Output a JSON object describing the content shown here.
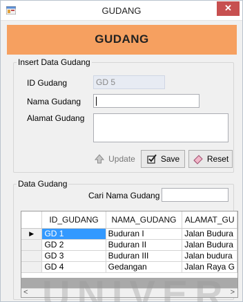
{
  "window": {
    "title": "GUDANG",
    "close_glyph": "✕",
    "icon": "app-window-icon",
    "close_color": "#c75050"
  },
  "banner": {
    "title": "GUDANG",
    "color": "#f6a060"
  },
  "insert_group": {
    "legend": "Insert Data Gudang",
    "id_label": "ID Gudang",
    "id_value": "GD 5",
    "nama_label": "Nama Gudang",
    "nama_value": "",
    "alamat_label": "Alamat Gudang",
    "alamat_value": "",
    "update_label": "Update",
    "save_label": "Save",
    "reset_label": "Reset"
  },
  "data_group": {
    "legend": "Data Gudang",
    "search_label": "Cari Nama Gudang :",
    "search_value": ""
  },
  "grid": {
    "columns": [
      "ID_GUDANG",
      "NAMA_GUDANG",
      "ALAMAT_GU"
    ],
    "rows": [
      {
        "id": "GD 1",
        "nama": "Buduran I",
        "alamat": "Jalan Budura"
      },
      {
        "id": "GD 2",
        "nama": "Buduran II",
        "alamat": "Jalan Budura"
      },
      {
        "id": "GD 3",
        "nama": "Buduran III",
        "alamat": "Jalan budura"
      },
      {
        "id": "GD 4",
        "nama": "Gedangan",
        "alamat": "Jalan Raya G"
      }
    ],
    "selected_row_marker": "▶",
    "selection_color": "#3399ff",
    "scroll_left": "<",
    "scroll_right": ">"
  },
  "watermark": "UNIVER"
}
